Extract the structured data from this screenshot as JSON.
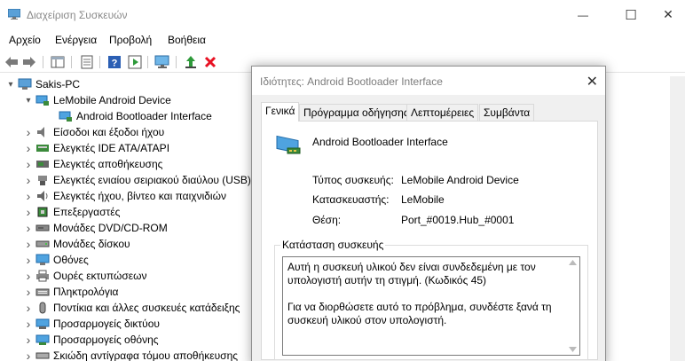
{
  "window": {
    "title": "Διαχείριση Συσκευών",
    "minimize": "—",
    "maximize": "☐",
    "close": "✕"
  },
  "menu": [
    "Αρχείο",
    "Ενέργεια",
    "Προβολή",
    "Βοήθεια"
  ],
  "tree": {
    "root": "Sakis-PC",
    "items": [
      {
        "label": "LeMobile Android Device",
        "expanded": true,
        "icon": "android-device-icon"
      },
      {
        "label": "Android Bootloader Interface",
        "child": true,
        "icon": "interface-icon"
      },
      {
        "label": "Είσοδοι και έξοδοι ήχου",
        "icon": "speaker-icon"
      },
      {
        "label": "Ελεγκτές IDE ATA/ATAPI",
        "icon": "ide-controller-icon"
      },
      {
        "label": "Ελεγκτές αποθήκευσης",
        "icon": "storage-controller-icon"
      },
      {
        "label": "Ελεγκτές ενιαίου σειριακού διαύλου (USB)",
        "icon": "usb-icon"
      },
      {
        "label": "Ελεγκτές ήχου, βίντεο και παιχνιδιών",
        "icon": "sound-icon"
      },
      {
        "label": "Επεξεργαστές",
        "icon": "processor-icon"
      },
      {
        "label": "Μονάδες DVD/CD-ROM",
        "icon": "dvd-icon"
      },
      {
        "label": "Μονάδες δίσκου",
        "icon": "disk-icon"
      },
      {
        "label": "Οθόνες",
        "icon": "monitor-icon"
      },
      {
        "label": "Ουρές εκτυπώσεων",
        "icon": "printer-icon"
      },
      {
        "label": "Πληκτρολόγια",
        "icon": "keyboard-icon"
      },
      {
        "label": "Ποντίκια και άλλες συσκευές κατάδειξης",
        "icon": "mouse-icon"
      },
      {
        "label": "Προσαρμογείς δικτύου",
        "icon": "network-icon"
      },
      {
        "label": "Προσαρμογείς οθόνης",
        "icon": "display-adapter-icon"
      },
      {
        "label": "Σκιώδη αντίγραφα τόμου αποθήκευσης",
        "icon": "volume-icon"
      }
    ]
  },
  "dialog": {
    "title": "Ιδιότητες: Android Bootloader Interface",
    "close": "✕",
    "tabs": [
      "Γενικά",
      "Πρόγραμμα οδήγησης",
      "Λεπτομέρειες",
      "Συμβάντα"
    ],
    "device_name": "Android Bootloader Interface",
    "fields": [
      {
        "label": "Τύπος συσκευής:",
        "value": "LeMobile Android Device"
      },
      {
        "label": "Κατασκευαστής:",
        "value": "LeMobile"
      },
      {
        "label": "Θέση:",
        "value": "Port_#0019.Hub_#0001"
      }
    ],
    "status_title": "Κατάσταση συσκευής",
    "status_lines": [
      "Αυτή η συσκευή υλικού δεν είναι συνδεδεμένη με τον",
      "υπολογιστή αυτήν τη στιγμή. (Κωδικός 45)",
      "",
      "Για να διορθώσετε αυτό το πρόβλημα, συνδέστε ξανά τη",
      "συσκευή υλικού στον υπολογιστή."
    ]
  },
  "colors": {
    "delete_red": "#e81123",
    "help_blue": "#2b5fb4",
    "green": "#2e9a3a"
  }
}
